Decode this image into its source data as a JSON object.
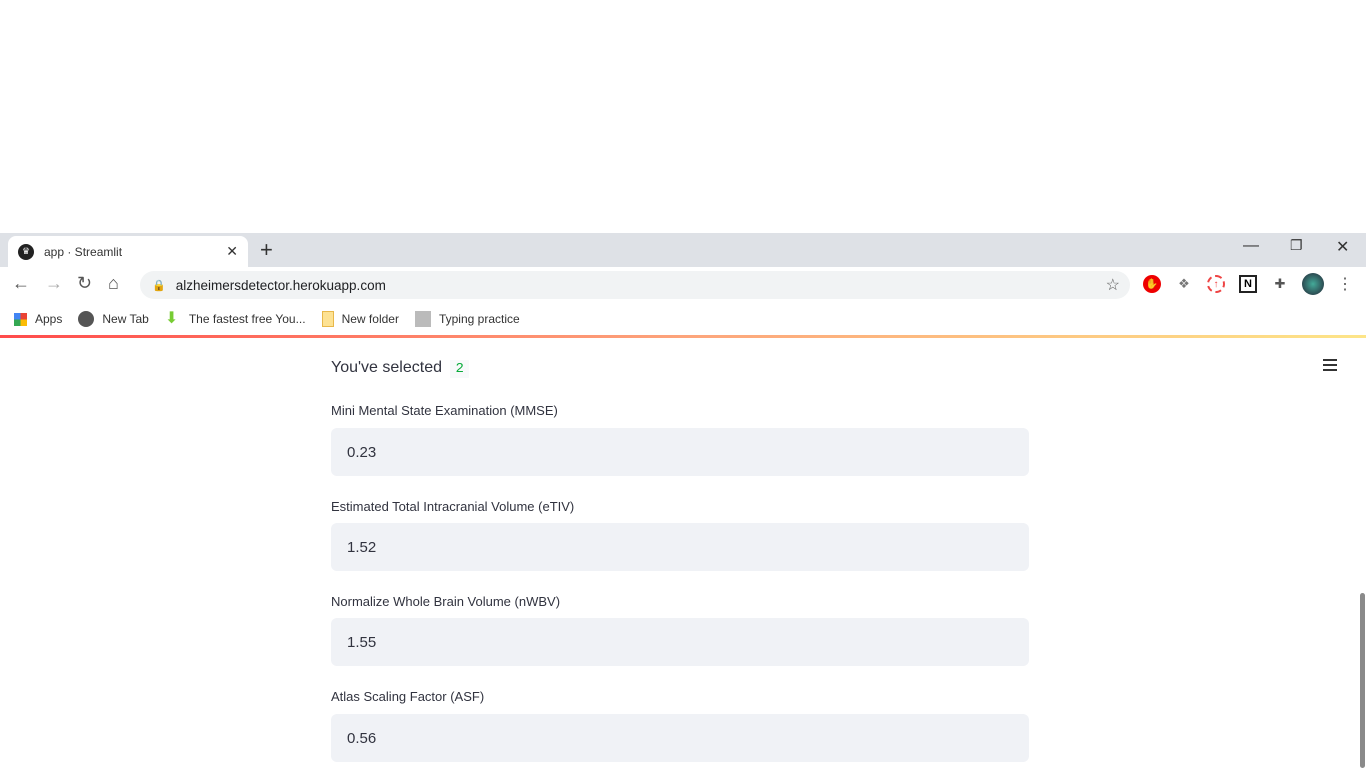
{
  "browser": {
    "tab_title": "app · Streamlit",
    "url": "alzheimersdetector.herokuapp.com",
    "bookmarks": [
      {
        "label": "Apps",
        "icon": "apps-grid-icon"
      },
      {
        "label": "New Tab",
        "icon": "globe-icon"
      },
      {
        "label": "The fastest free You...",
        "icon": "download-arrow-icon"
      },
      {
        "label": "New folder",
        "icon": "folder-icon"
      },
      {
        "label": "Typing practice",
        "icon": "typing-icon"
      }
    ],
    "extensions": [
      "adblock-icon",
      "dropbox-icon",
      "upload-icon",
      "notion-icon",
      "puzzle-icon",
      "profile-avatar"
    ]
  },
  "app": {
    "selected_label": "You've selected",
    "selected_value": "2",
    "fields": [
      {
        "label": "Mini Mental State Examination (MMSE)",
        "value": "0.23"
      },
      {
        "label": "Estimated Total Intracranial Volume (eTIV)",
        "value": "1.52"
      },
      {
        "label": "Normalize Whole Brain Volume (nWBV)",
        "value": "1.55"
      },
      {
        "label": "Atlas Scaling Factor (ASF)",
        "value": "0.56"
      }
    ]
  },
  "colors": {
    "accent_gradient_start": "#ff4b4b",
    "accent_gradient_end": "#fde588",
    "input_bg": "#f0f2f6",
    "code_text": "#09ab3b"
  }
}
